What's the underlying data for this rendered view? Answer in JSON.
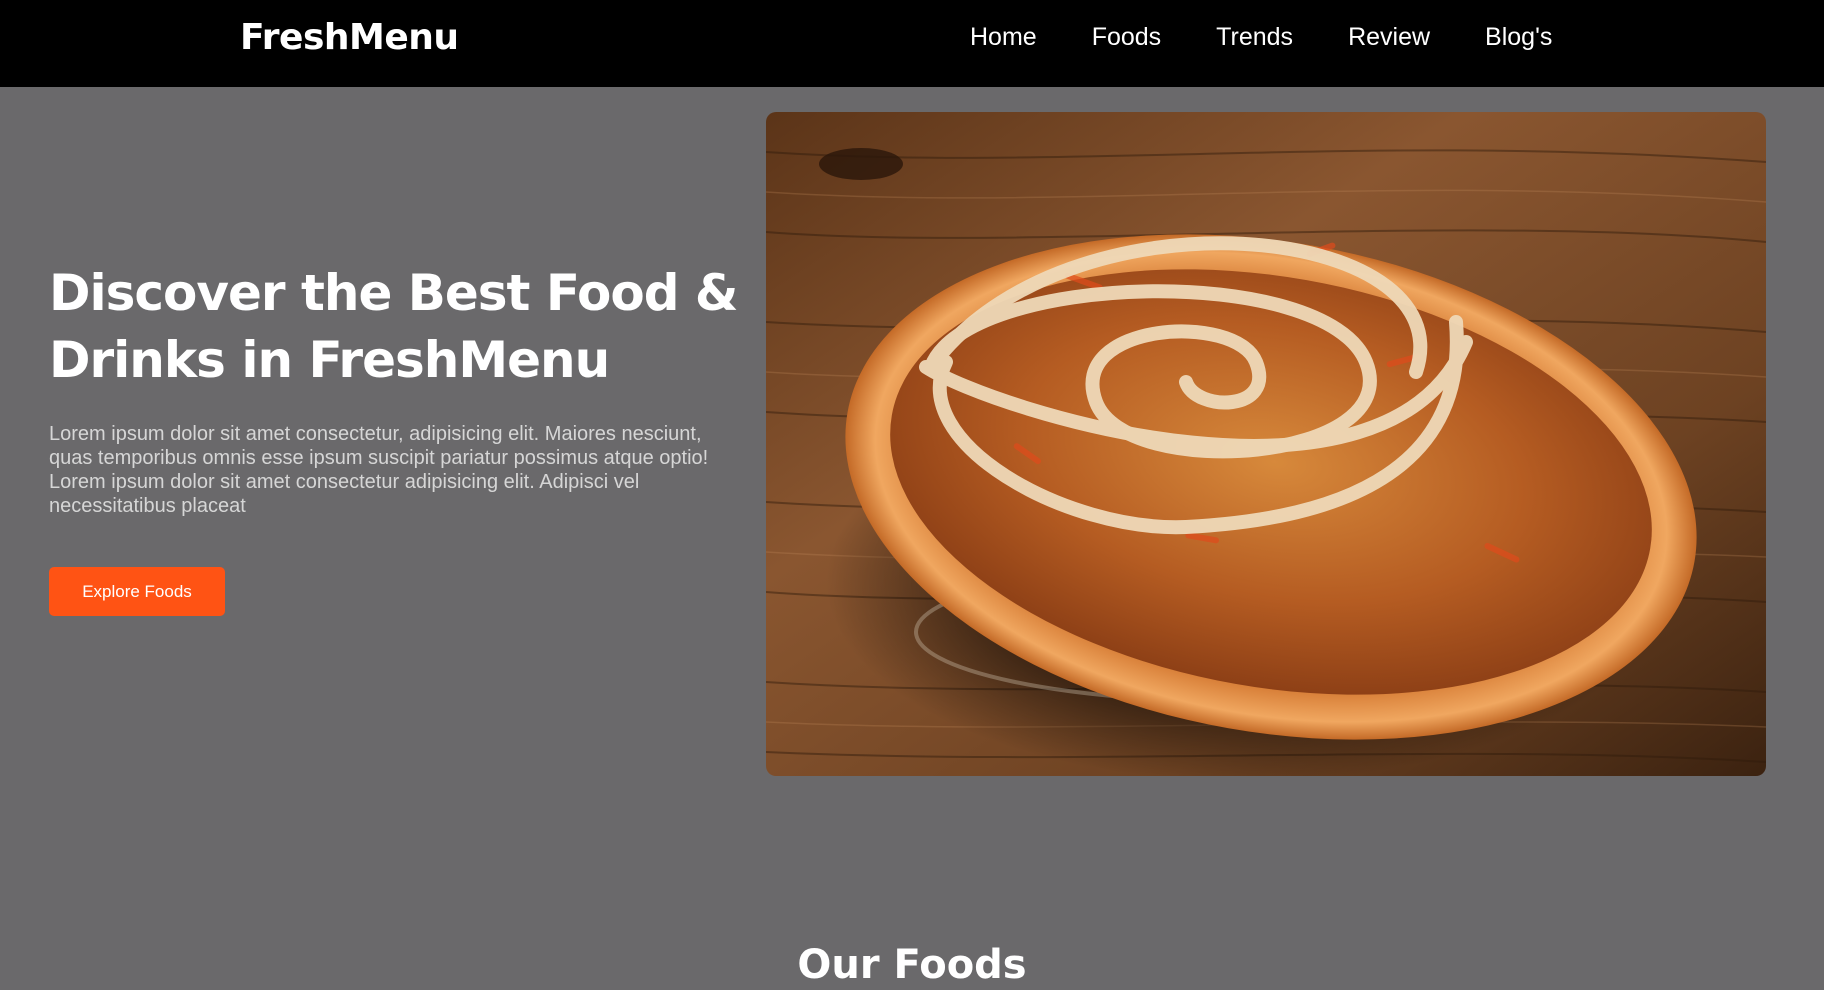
{
  "navbar": {
    "brand": "FreshMenu",
    "links": [
      "Home",
      "Foods",
      "Trends",
      "Review",
      "Blog's"
    ]
  },
  "hero": {
    "title_line1": "Discover the Best Food &",
    "title_line2": "Drinks in FreshMenu",
    "description": "Lorem ipsum dolor sit amet consectetur, adipisicing elit. Maiores nesciunt, quas temporibus omnis esse ipsum suscipit pariatur possimus atque optio! Lorem ipsum dolor sit amet consectetur adipisicing elit. Adipisci vel necessitatibus placeat",
    "button_label": "Explore Foods"
  },
  "section": {
    "heading": "Our Foods"
  },
  "colors": {
    "navbar_bg": "#000000",
    "page_bg": "#6a696b",
    "accent": "#ff5314"
  }
}
